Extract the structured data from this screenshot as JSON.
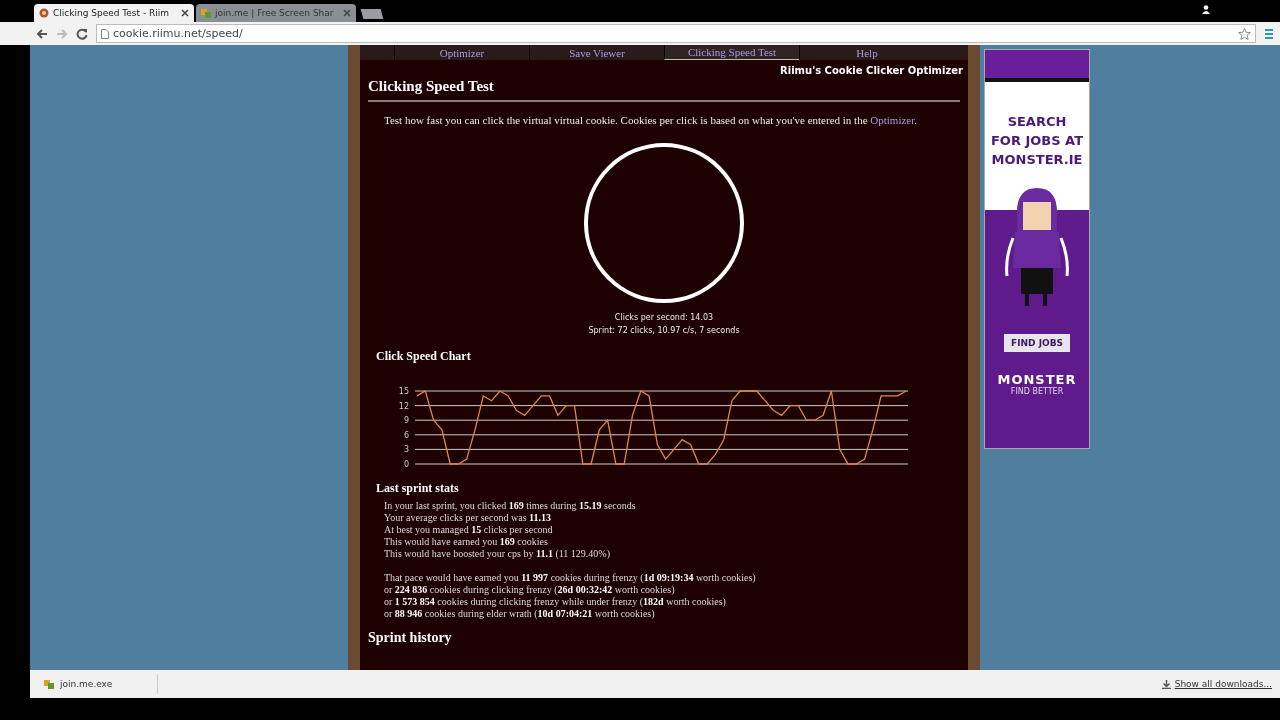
{
  "browser": {
    "tabs": [
      {
        "title": "Clicking Speed Test - Riim",
        "selected": true
      },
      {
        "title": "join.me | Free Screen Shar",
        "selected": false
      }
    ],
    "url": "cookie.riimu.net/speed/"
  },
  "nav": {
    "items": [
      {
        "label": "Optimizer",
        "selected": false
      },
      {
        "label": "Save Viewer",
        "selected": false
      },
      {
        "label": "Clicking Speed Test",
        "selected": true
      },
      {
        "label": "Help",
        "selected": false
      }
    ]
  },
  "site_title": "Riimu's Cookie Clicker Optimizer",
  "page_title": "Clicking Speed Test",
  "intro": {
    "text": "Test how fast you can click the virtual virtual cookie. Cookies per click is based on what you've entered in the",
    "link": "Optimizer",
    "after": "."
  },
  "readouts": [
    "Clicks per second: 14.03",
    "Sprint: 72 clicks, 10.97 c/s, 7 seconds"
  ],
  "chart_section": {
    "title": "Click Speed Chart",
    "chart_data": {
      "type": "line",
      "grid": true,
      "ylim": [
        0,
        15
      ],
      "yticks": [
        0,
        3,
        6,
        9,
        12,
        15
      ],
      "values": [
        14,
        15,
        9,
        7,
        0,
        0,
        1,
        7,
        14,
        13,
        15,
        14,
        11,
        10,
        12,
        14,
        14,
        10,
        12,
        12,
        0,
        0,
        7,
        9,
        0,
        0,
        10,
        15,
        14,
        4,
        1,
        3,
        5,
        4,
        0,
        0,
        2,
        5,
        13,
        15,
        15,
        15,
        13,
        11,
        10,
        12,
        12,
        9,
        9,
        10,
        15,
        3,
        0,
        0,
        1,
        7,
        14,
        14,
        14,
        15
      ]
    }
  },
  "stats": {
    "title": "Last sprint stats",
    "groups": [
      [
        "In your last sprint, you clicked **169** times during **15.19** seconds",
        "Your average clicks per second was **11.13**",
        "At best you managed **15** clicks per second",
        "This would have earned you **169** cookies",
        "This would have boosted your cps by **11.1** (11 129.40%)"
      ],
      [
        "That pace would have earned you **11 997** cookies during frenzy (**1d 09:19:34** worth cookies)",
        "or **224 836** cookies during clicking frenzy (**26d 00:32:42** worth cookies)",
        "or **1 573 854** cookies during clicking frenzy while under frenzy (**182d** worth cookies)",
        "or **88 946** cookies during elder wrath (**10d 07:04:21** worth cookies)"
      ]
    ]
  },
  "next_heading": "Sprint history",
  "ad": {
    "headline": [
      "SEARCH",
      "FOR JOBS AT",
      "MONSTER.IE"
    ],
    "button": "FIND JOBS",
    "brand": "MONSTER",
    "tagline": "FIND BETTER"
  },
  "downloads": {
    "items": [
      {
        "name": "join.me.exe"
      }
    ],
    "show_all": "Show all downloads..."
  }
}
